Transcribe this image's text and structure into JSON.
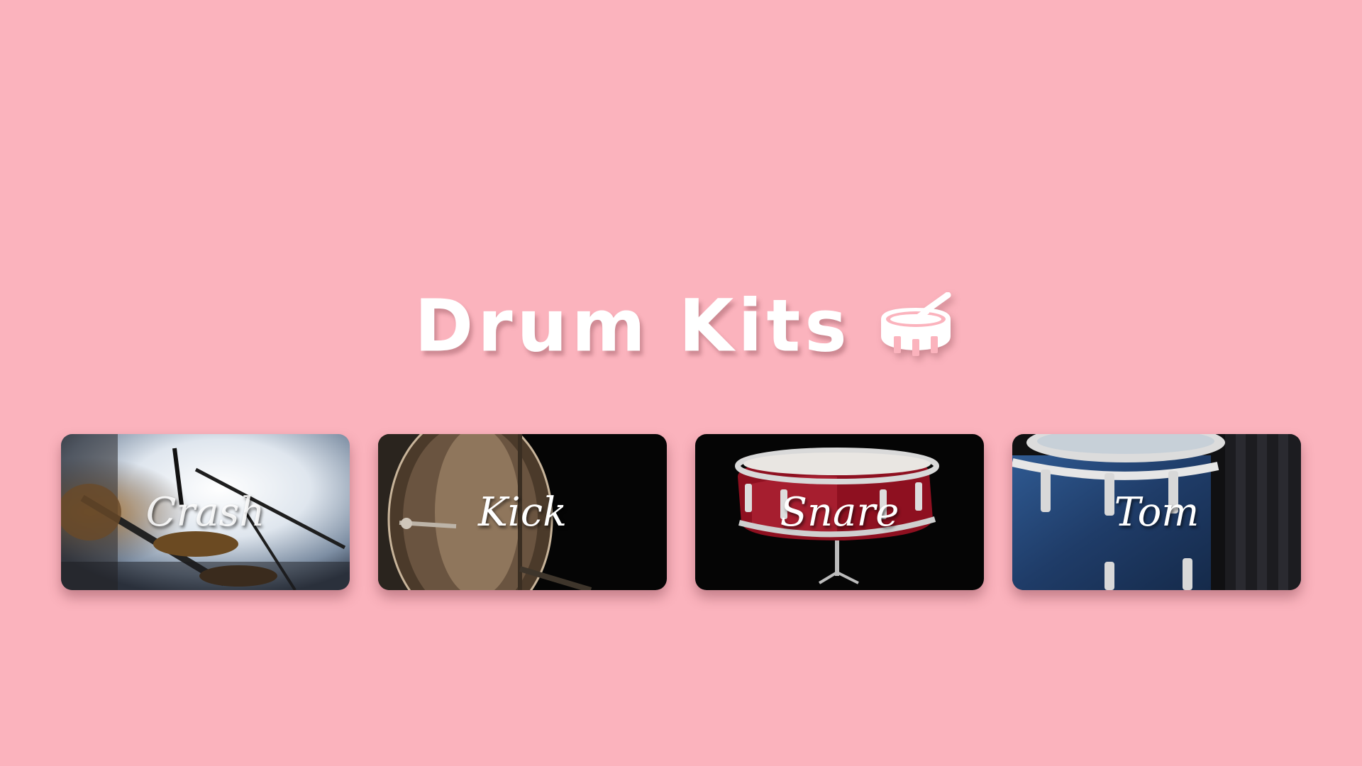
{
  "header": {
    "title": "Drum Kits",
    "icon": "drum-icon"
  },
  "cards": [
    {
      "label": "Crash",
      "icon": "cymbal-image"
    },
    {
      "label": "Kick",
      "icon": "bass-drum-image"
    },
    {
      "label": "Snare",
      "icon": "snare-drum-image"
    },
    {
      "label": "Tom",
      "icon": "tom-drum-image"
    }
  ],
  "colors": {
    "background": "#fbb3bd",
    "title": "#ffffff",
    "snare_red": "#8e1020",
    "tom_blue": "#23406e"
  }
}
